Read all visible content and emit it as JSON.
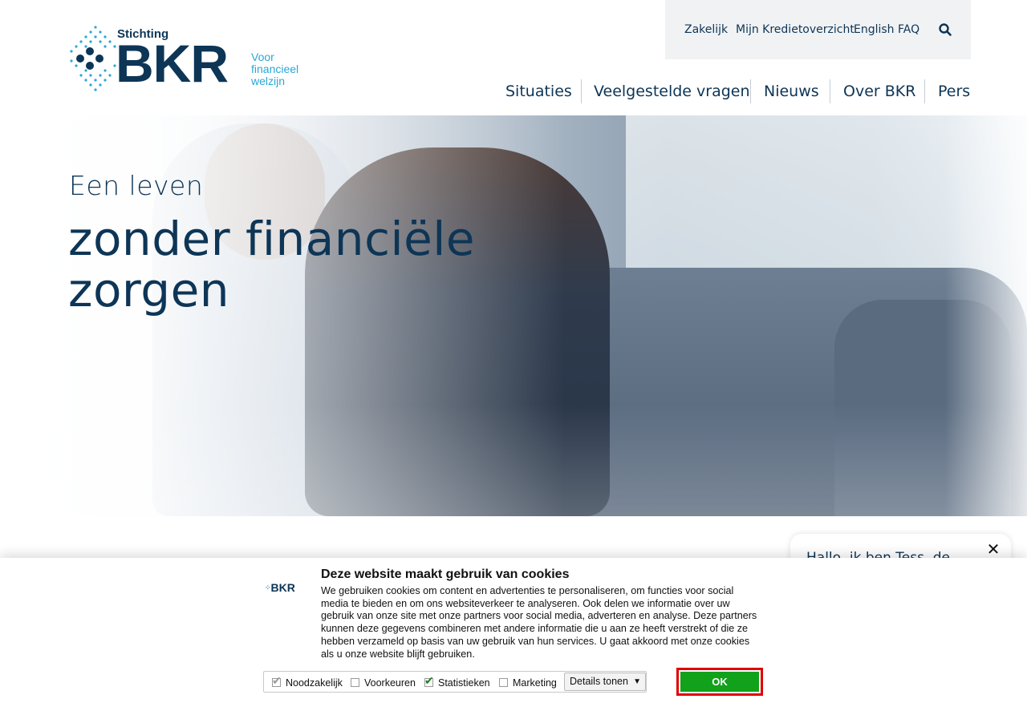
{
  "header": {
    "logo_small": "Stichting",
    "logo_big": "BKR",
    "logo_tagline": "Voor financieel welzijn"
  },
  "topbar": {
    "links": [
      "Zakelijk",
      "Mijn Kredietoverzicht",
      "English FAQ"
    ],
    "search_icon": "search-icon"
  },
  "mainnav": {
    "items": [
      "Situaties",
      "Veelgestelde vragen",
      "Nieuws",
      "Over BKR",
      "Pers"
    ]
  },
  "hero": {
    "subtitle": "Een leven",
    "title": "zonder financiële zorgen"
  },
  "chat": {
    "message": "Hallo, ik ben Tess, de",
    "close_icon": "close-icon"
  },
  "cookie": {
    "logo": "BKR",
    "title": "Deze website maakt gebruik van cookies",
    "text": "We gebruiken cookies om content en advertenties te personaliseren, om functies voor social media te bieden en om ons websiteverkeer te analyseren. Ook delen we informatie over uw gebruik van onze site met onze partners voor social media, adverteren en analyse. Deze partners kunnen deze gegevens combineren met andere informatie die u aan ze heeft verstrekt of die ze hebben verzameld op basis van uw gebruik van hun services. U gaat akkoord met onze cookies als u onze website blijft gebruiken.",
    "options": [
      {
        "label": "Noodzakelijk",
        "checked": true,
        "disabled": true
      },
      {
        "label": "Voorkeuren",
        "checked": false
      },
      {
        "label": "Statistieken",
        "checked": true
      },
      {
        "label": "Marketing",
        "checked": false
      }
    ],
    "details_label": "Details tonen",
    "ok_label": "OK"
  },
  "colors": {
    "navy": "#0d3556",
    "accent_blue": "#2aa7d6",
    "ok_green": "#12a11b",
    "highlight_red": "#e00000"
  }
}
